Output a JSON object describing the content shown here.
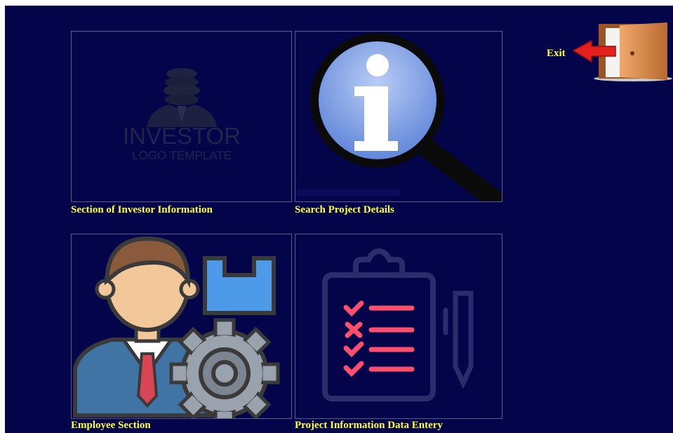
{
  "tiles": {
    "investor": {
      "caption": "Section of Investor Information",
      "logo_line1": "INVESTOR",
      "logo_line2": "LOGO TEMPLATE",
      "icon": "investor-logo-icon"
    },
    "search": {
      "caption": "Search Project Details",
      "icon": "info-magnifier-icon"
    },
    "employee": {
      "caption": "Employee Section",
      "icon": "employee-gear-icon"
    },
    "project_data": {
      "caption": "Project Information Data Entery",
      "icon": "clipboard-checklist-icon"
    }
  },
  "exit": {
    "label": "Exit",
    "icon": "exit-door-icon"
  },
  "colors": {
    "background": "#04044a",
    "caption": "#ffff3a",
    "border": "#5a5c8a"
  }
}
